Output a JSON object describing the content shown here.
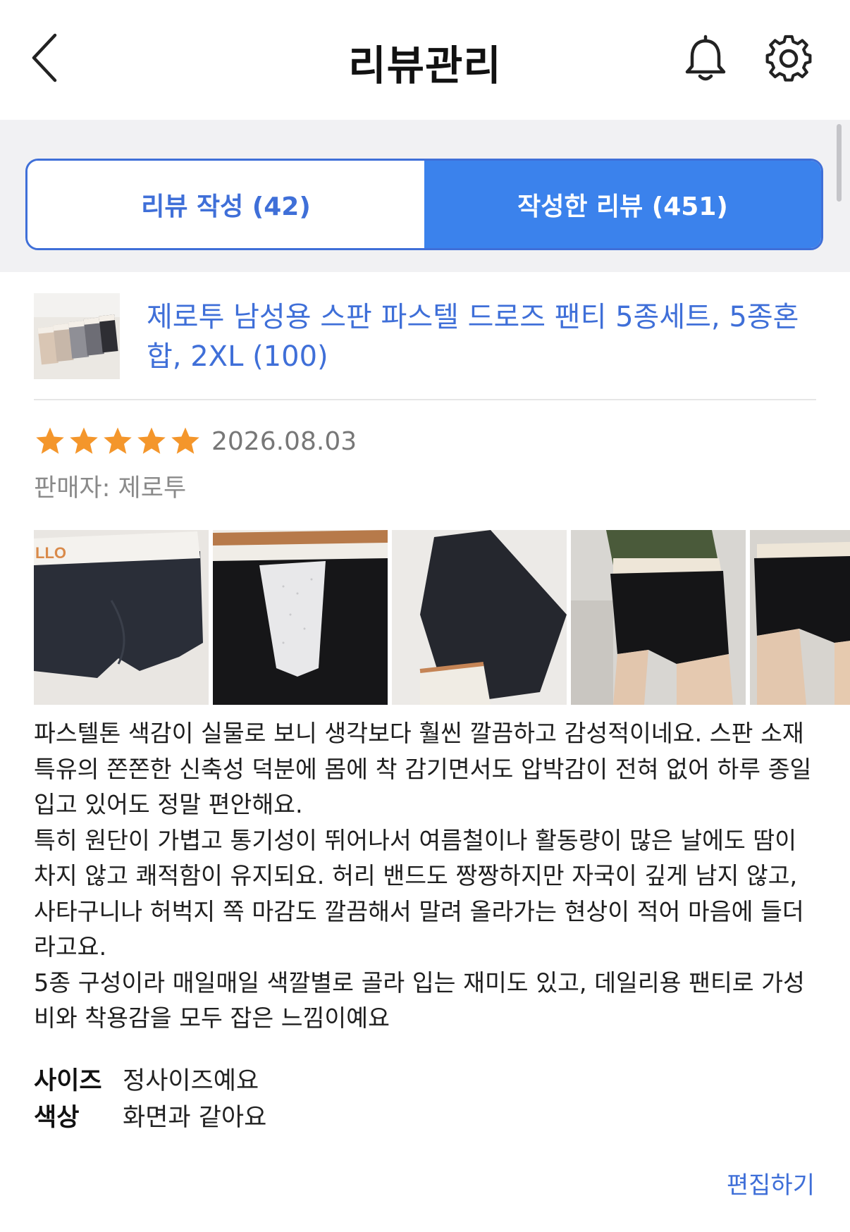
{
  "header": {
    "title": "리뷰관리",
    "back_icon": "chevron-left-icon",
    "bell_icon": "bell-icon",
    "settings_icon": "gear-icon"
  },
  "tabs": [
    {
      "label": "리뷰 작성 (42)",
      "active": false
    },
    {
      "label": "작성한 리뷰 (451)",
      "active": true
    }
  ],
  "colors": {
    "accent": "#3f6fd8",
    "active_tab": "#3b82ec",
    "star": "#f4962b"
  },
  "review": {
    "product_name": "제로투 남성용 스판 파스텔 드로즈 팬티 5종세트, 5종혼합, 2XL (100)",
    "rating": 5,
    "date": "2026.08.03",
    "seller_label": "판매자:",
    "seller_name": "제로투",
    "body": "파스텔톤 색감이 실물로 보니 생각보다 훨씬 깔끔하고 감성적이네요. 스판 소재 특유의 쫀쫀한 신축성 덕분에 몸에 착 감기면서도 압박감이 전혀 없어 하루 종일 입고 있어도 정말 편안해요.\n특히 원단이 가볍고 통기성이 뛰어나서 여름철이나 활동량이 많은 날에도 땀이 차지 않고 쾌적함이 유지되요. 허리 밴드도 짱짱하지만 자국이 깊게 남지 않고, 사타구니나 허벅지 쪽 마감도 깔끔해서 말려 올라가는 현상이 적어 마음에 들더라고요.\n5종 구성이라 매일매일 색깔별로 골라 입는 재미도 있고, 데일리용 팬티로 가성비와 착용감을 모두 잡은 느낌이예요",
    "attributes": [
      {
        "label": "사이즈",
        "value": "정사이즈예요"
      },
      {
        "label": "색상",
        "value": "화면과 같아요"
      }
    ],
    "edit_label": "편집하기"
  }
}
